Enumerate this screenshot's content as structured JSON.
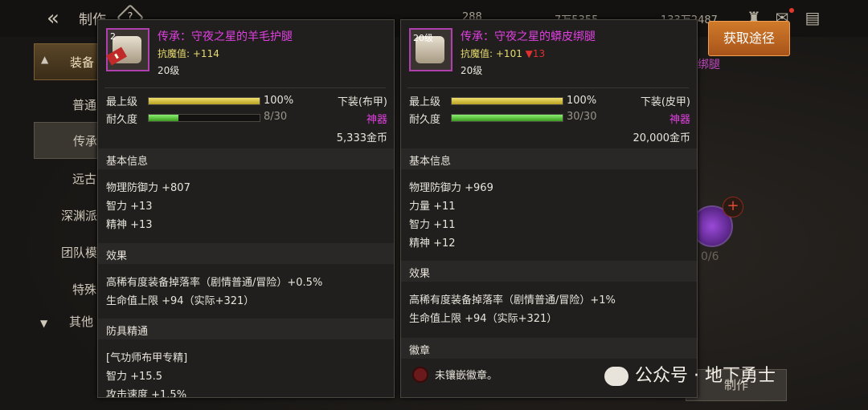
{
  "header": {
    "title": "制作",
    "help": "?",
    "currencies": [
      "288",
      "7万5355",
      "133万2487"
    ]
  },
  "sidebar": {
    "header_label": "装备",
    "items": [
      "普通",
      "传承",
      "远古",
      "深渊派",
      "团队模",
      "特殊"
    ],
    "other_label": "其他"
  },
  "right_pane": {
    "get_button": "获取途径",
    "craft_button": "制作",
    "count": "0/6",
    "pink_label": "绑腿"
  },
  "items": [
    {
      "thumb_level": "2",
      "name": "传承：守夜之星的羊毛护腿",
      "resist_label": "抗魔值:",
      "resist_value": "+114",
      "resist_down": "",
      "level": "20级",
      "top_label": "最上级",
      "top_pct": "100%",
      "top_fill": 1.0,
      "dur_label": "耐久度",
      "dur_value": "8/30",
      "dur_fill": 0.27,
      "slot": "下装(布甲)",
      "rarity": "神器",
      "price": "5,333金币",
      "basic_title": "基本信息",
      "basic": [
        "物理防御力 +807",
        "智力 +13",
        "精神 +13"
      ],
      "effect_title": "效果",
      "effects": [
        "高稀有度装备掉落率（剧情普通/冒险）+0.5%",
        "生命值上限 +94（实际+321）"
      ],
      "extra_title": "防具精通",
      "extra": [
        "[气功师布甲专精]",
        "智力 +15.5",
        "攻击速度 +1.5%"
      ]
    },
    {
      "thumb_level": "20级",
      "name": "传承：守夜之星的蟒皮绑腿",
      "resist_label": "抗魔值:",
      "resist_value": "+101",
      "resist_down": "▼13",
      "level": "20级",
      "top_label": "最上级",
      "top_pct": "100%",
      "top_fill": 1.0,
      "dur_label": "耐久度",
      "dur_value": "30/30",
      "dur_fill": 1.0,
      "slot": "下装(皮甲)",
      "rarity": "神器",
      "price": "20,000金币",
      "basic_title": "基本信息",
      "basic": [
        "物理防御力 +969",
        "力量 +11",
        "智力 +11",
        "精神 +12"
      ],
      "effect_title": "效果",
      "effects": [
        "高稀有度装备掉落率（剧情普通/冒险）+1%",
        "生命值上限 +94（实际+321）"
      ],
      "emblem_title": "徽章",
      "emblem_text": "未镶嵌徽章。"
    }
  ],
  "watermark": "公众号 · 地下勇士",
  "colors": {
    "name_purple": "#e040e0",
    "resist_yellow": "#e8dc70",
    "down_red": "#e03030",
    "accent_orange": "#d07a2a"
  }
}
